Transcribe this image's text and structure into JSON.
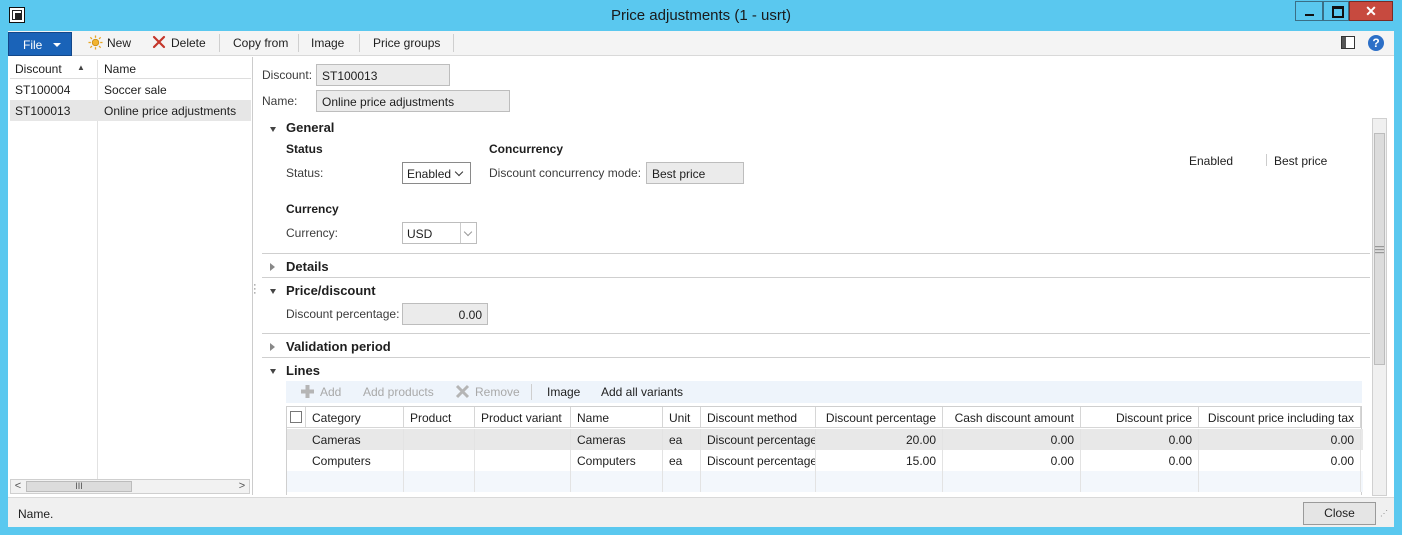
{
  "window": {
    "title": "Price adjustments (1 - usrt)",
    "close_glyph": "✕"
  },
  "toolbar": {
    "file": "File",
    "new": "New",
    "delete": "Delete",
    "copy_from": "Copy from",
    "image": "Image",
    "price_groups": "Price groups",
    "help_glyph": "?"
  },
  "list": {
    "col_discount": "Discount",
    "col_name": "Name",
    "sort_glyph": "▲",
    "rows": [
      {
        "discount": "ST100004",
        "name": "Soccer sale"
      },
      {
        "discount": "ST100013",
        "name": "Online price adjustments"
      }
    ],
    "scroll_left": "<",
    "scroll_right": ">",
    "scroll_grip": "III"
  },
  "header": {
    "discount_label": "Discount:",
    "discount_value": "ST100013",
    "name_label": "Name:",
    "name_value": "Online price adjustments"
  },
  "general": {
    "title": "General",
    "summary_status": "Enabled",
    "summary_concurrency": "Best price",
    "status_group": "Status",
    "status_label": "Status:",
    "status_value": "Enabled",
    "concurrency_group": "Concurrency",
    "concurrency_label": "Discount concurrency mode:",
    "concurrency_value": "Best price",
    "currency_group": "Currency",
    "currency_label": "Currency:",
    "currency_value": "USD"
  },
  "details": {
    "title": "Details"
  },
  "price_discount": {
    "title": "Price/discount",
    "pct_label": "Discount percentage:",
    "pct_value": "0.00"
  },
  "validation": {
    "title": "Validation period"
  },
  "lines": {
    "title": "Lines",
    "tb_add": "Add",
    "tb_add_products": "Add products",
    "tb_remove": "Remove",
    "tb_image": "Image",
    "tb_add_all_variants": "Add all variants",
    "columns": [
      "Category",
      "Product",
      "Product variant",
      "Name",
      "Unit",
      "Discount method",
      "Discount percentage",
      "Cash discount amount",
      "Discount price",
      "Discount price including tax"
    ],
    "rows": [
      [
        "Cameras",
        "",
        "",
        "Cameras",
        "ea",
        "Discount percentage",
        "20.00",
        "0.00",
        "0.00",
        "0.00"
      ],
      [
        "Computers",
        "",
        "",
        "Computers",
        "ea",
        "Discount percentage",
        "15.00",
        "0.00",
        "0.00",
        "0.00"
      ]
    ]
  },
  "statusbar": {
    "text": "Name.",
    "close": "Close"
  }
}
